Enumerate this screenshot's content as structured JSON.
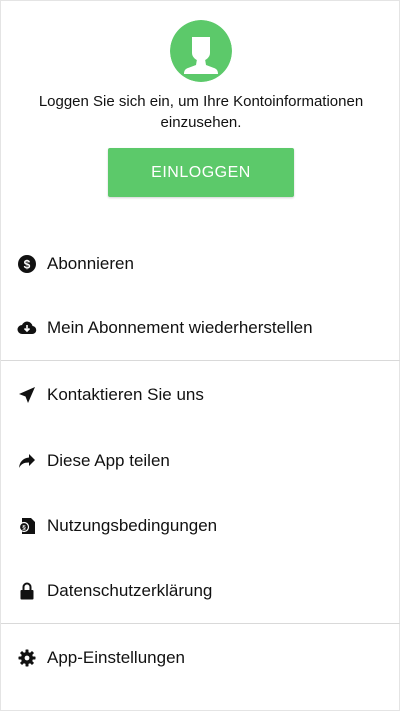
{
  "colors": {
    "accent_green": "#5cc96a",
    "text": "#111111",
    "divider": "#d9d9d9"
  },
  "profile": {
    "avatar_icon": "user-avatar-icon",
    "login_prompt": "Loggen Sie sich ein, um Ihre Kontoinformationen einzusehen.",
    "login_button_label": "EINLOGGEN"
  },
  "menu": {
    "section1": [
      {
        "icon": "dollar-circle-icon",
        "label": "Abonnieren"
      },
      {
        "icon": "cloud-download-icon",
        "label": "Mein Abonnement wiederherstellen"
      }
    ],
    "section2": [
      {
        "icon": "paper-plane-icon",
        "label": "Kontaktieren Sie uns"
      },
      {
        "icon": "share-arrow-icon",
        "label": "Diese App teilen"
      },
      {
        "icon": "document-terms-icon",
        "label": "Nutzungsbedingungen"
      },
      {
        "icon": "lock-icon",
        "label": "Datenschutzerklärung"
      }
    ],
    "section3": [
      {
        "icon": "gear-icon",
        "label": "App-Einstellungen"
      }
    ]
  }
}
